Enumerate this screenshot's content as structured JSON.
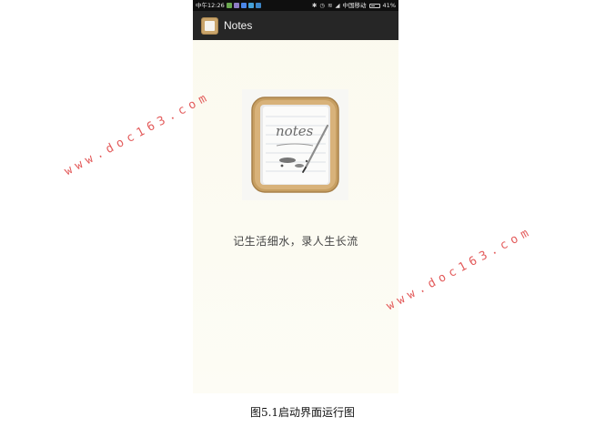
{
  "status_bar": {
    "time": "中午12:26",
    "carrier": "中国移动",
    "battery": "41%",
    "icons": [
      "app-notification-icon",
      "bluetooth-icon",
      "alarm-icon",
      "wifi-icon",
      "signal-icon",
      "battery-icon"
    ]
  },
  "app_bar": {
    "title": "Notes"
  },
  "splash": {
    "icon_text": "notes",
    "tagline": "记生活细水，录人生长流"
  },
  "caption": "图5.1启动界面运行图",
  "watermarks": [
    "www.doc163.com",
    "www.doc163.com"
  ],
  "colors": {
    "status_bar_bg": "#0f0f0f",
    "app_bar_bg": "#262626",
    "screen_bg": "#fbf9ee",
    "watermark": "#e04a4a",
    "icon_frame": "#c9a46a"
  }
}
